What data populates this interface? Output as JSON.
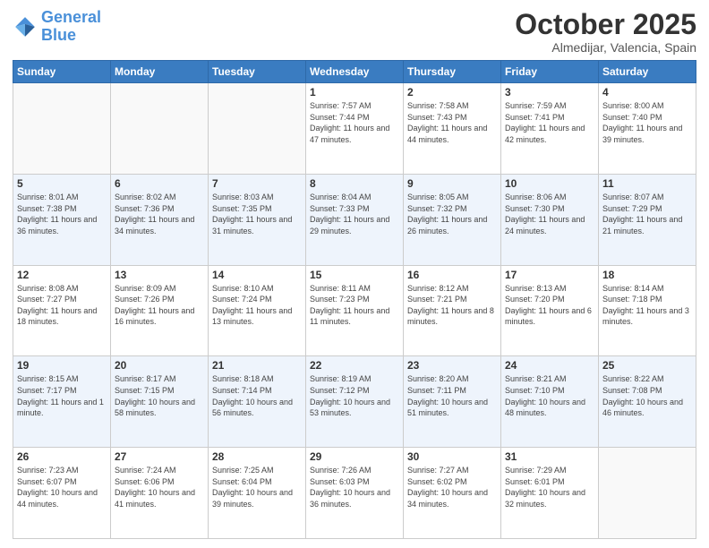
{
  "header": {
    "logo_line1": "General",
    "logo_line2": "Blue",
    "month": "October 2025",
    "location": "Almedijar, Valencia, Spain"
  },
  "weekdays": [
    "Sunday",
    "Monday",
    "Tuesday",
    "Wednesday",
    "Thursday",
    "Friday",
    "Saturday"
  ],
  "rows": [
    [
      {
        "day": "",
        "info": ""
      },
      {
        "day": "",
        "info": ""
      },
      {
        "day": "",
        "info": ""
      },
      {
        "day": "1",
        "info": "Sunrise: 7:57 AM\nSunset: 7:44 PM\nDaylight: 11 hours\nand 47 minutes."
      },
      {
        "day": "2",
        "info": "Sunrise: 7:58 AM\nSunset: 7:43 PM\nDaylight: 11 hours\nand 44 minutes."
      },
      {
        "day": "3",
        "info": "Sunrise: 7:59 AM\nSunset: 7:41 PM\nDaylight: 11 hours\nand 42 minutes."
      },
      {
        "day": "4",
        "info": "Sunrise: 8:00 AM\nSunset: 7:40 PM\nDaylight: 11 hours\nand 39 minutes."
      }
    ],
    [
      {
        "day": "5",
        "info": "Sunrise: 8:01 AM\nSunset: 7:38 PM\nDaylight: 11 hours\nand 36 minutes."
      },
      {
        "day": "6",
        "info": "Sunrise: 8:02 AM\nSunset: 7:36 PM\nDaylight: 11 hours\nand 34 minutes."
      },
      {
        "day": "7",
        "info": "Sunrise: 8:03 AM\nSunset: 7:35 PM\nDaylight: 11 hours\nand 31 minutes."
      },
      {
        "day": "8",
        "info": "Sunrise: 8:04 AM\nSunset: 7:33 PM\nDaylight: 11 hours\nand 29 minutes."
      },
      {
        "day": "9",
        "info": "Sunrise: 8:05 AM\nSunset: 7:32 PM\nDaylight: 11 hours\nand 26 minutes."
      },
      {
        "day": "10",
        "info": "Sunrise: 8:06 AM\nSunset: 7:30 PM\nDaylight: 11 hours\nand 24 minutes."
      },
      {
        "day": "11",
        "info": "Sunrise: 8:07 AM\nSunset: 7:29 PM\nDaylight: 11 hours\nand 21 minutes."
      }
    ],
    [
      {
        "day": "12",
        "info": "Sunrise: 8:08 AM\nSunset: 7:27 PM\nDaylight: 11 hours\nand 18 minutes."
      },
      {
        "day": "13",
        "info": "Sunrise: 8:09 AM\nSunset: 7:26 PM\nDaylight: 11 hours\nand 16 minutes."
      },
      {
        "day": "14",
        "info": "Sunrise: 8:10 AM\nSunset: 7:24 PM\nDaylight: 11 hours\nand 13 minutes."
      },
      {
        "day": "15",
        "info": "Sunrise: 8:11 AM\nSunset: 7:23 PM\nDaylight: 11 hours\nand 11 minutes."
      },
      {
        "day": "16",
        "info": "Sunrise: 8:12 AM\nSunset: 7:21 PM\nDaylight: 11 hours\nand 8 minutes."
      },
      {
        "day": "17",
        "info": "Sunrise: 8:13 AM\nSunset: 7:20 PM\nDaylight: 11 hours\nand 6 minutes."
      },
      {
        "day": "18",
        "info": "Sunrise: 8:14 AM\nSunset: 7:18 PM\nDaylight: 11 hours\nand 3 minutes."
      }
    ],
    [
      {
        "day": "19",
        "info": "Sunrise: 8:15 AM\nSunset: 7:17 PM\nDaylight: 11 hours\nand 1 minute."
      },
      {
        "day": "20",
        "info": "Sunrise: 8:17 AM\nSunset: 7:15 PM\nDaylight: 10 hours\nand 58 minutes."
      },
      {
        "day": "21",
        "info": "Sunrise: 8:18 AM\nSunset: 7:14 PM\nDaylight: 10 hours\nand 56 minutes."
      },
      {
        "day": "22",
        "info": "Sunrise: 8:19 AM\nSunset: 7:12 PM\nDaylight: 10 hours\nand 53 minutes."
      },
      {
        "day": "23",
        "info": "Sunrise: 8:20 AM\nSunset: 7:11 PM\nDaylight: 10 hours\nand 51 minutes."
      },
      {
        "day": "24",
        "info": "Sunrise: 8:21 AM\nSunset: 7:10 PM\nDaylight: 10 hours\nand 48 minutes."
      },
      {
        "day": "25",
        "info": "Sunrise: 8:22 AM\nSunset: 7:08 PM\nDaylight: 10 hours\nand 46 minutes."
      }
    ],
    [
      {
        "day": "26",
        "info": "Sunrise: 7:23 AM\nSunset: 6:07 PM\nDaylight: 10 hours\nand 44 minutes."
      },
      {
        "day": "27",
        "info": "Sunrise: 7:24 AM\nSunset: 6:06 PM\nDaylight: 10 hours\nand 41 minutes."
      },
      {
        "day": "28",
        "info": "Sunrise: 7:25 AM\nSunset: 6:04 PM\nDaylight: 10 hours\nand 39 minutes."
      },
      {
        "day": "29",
        "info": "Sunrise: 7:26 AM\nSunset: 6:03 PM\nDaylight: 10 hours\nand 36 minutes."
      },
      {
        "day": "30",
        "info": "Sunrise: 7:27 AM\nSunset: 6:02 PM\nDaylight: 10 hours\nand 34 minutes."
      },
      {
        "day": "31",
        "info": "Sunrise: 7:29 AM\nSunset: 6:01 PM\nDaylight: 10 hours\nand 32 minutes."
      },
      {
        "day": "",
        "info": ""
      }
    ]
  ]
}
